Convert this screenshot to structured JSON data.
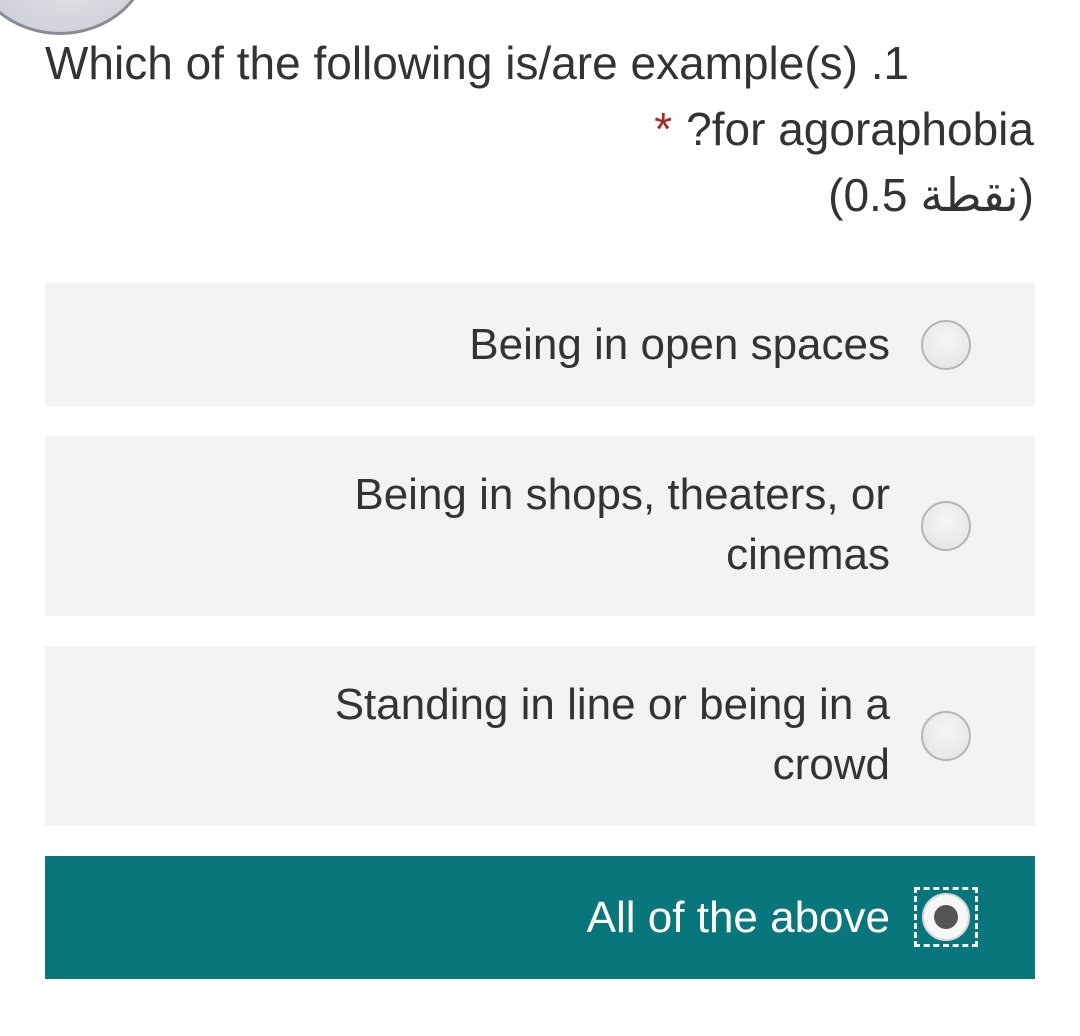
{
  "question": {
    "line1": "Which of the following is/are example(s)  .1",
    "line2": "?for agoraphobia",
    "required_mark": "*",
    "points": "(0.5 نقطة)"
  },
  "options": [
    {
      "label": "Being in open spaces",
      "selected": false
    },
    {
      "label": "Being in shops, theaters, or cinemas",
      "selected": false
    },
    {
      "label": "Standing in line or being in a crowd",
      "selected": false
    },
    {
      "label": "All of the above",
      "selected": true
    }
  ],
  "colors": {
    "selected_background": "#08767a",
    "option_background": "#f3f3f3",
    "required": "#a52a2a",
    "text": "#333333"
  }
}
